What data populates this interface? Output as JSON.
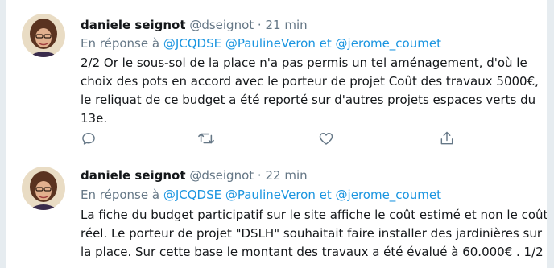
{
  "tweets": [
    {
      "name": "daniele seignot",
      "handle": "@dseignot",
      "dot": "·",
      "time": "21 min",
      "reply_prefix": "En réponse à",
      "mentions": [
        "@JCQDSE",
        "@PaulineVeron",
        "@jerome_coumet"
      ],
      "reply_sep": "et",
      "lines": [
        "2/2  Or le sous-sol de la place n'a pas permis un tel aménagement, d'où le",
        "choix des pots en accord avec le porteur de projet Coût des travaux 5000€,",
        "le reliquat de ce budget a été reporté sur d'autres projets espaces verts du",
        "13e."
      ],
      "actions": [
        "reply-icon",
        "retweet-icon",
        "like-icon",
        "share-icon"
      ]
    },
    {
      "name": "daniele seignot",
      "handle": "@dseignot",
      "dot": "·",
      "time": "22 min",
      "reply_prefix": "En réponse à",
      "mentions": [
        "@JCQDSE",
        "@PaulineVeron",
        "@jerome_coumet"
      ],
      "reply_sep": "et",
      "lines": [
        "La fiche du budget participatif sur le site affiche le coût estimé et non le coût",
        "réel. Le porteur de projet \"DSLH\" souhaitait faire installer des jardinières sur",
        "la place. Sur cette base le montant des travaux a été évalué à 60.000€ . 1/2"
      ]
    }
  ],
  "colors": {
    "text": "#14171a",
    "muted": "#657786",
    "link": "#1b95e0",
    "divider": "#e6ecf0"
  }
}
